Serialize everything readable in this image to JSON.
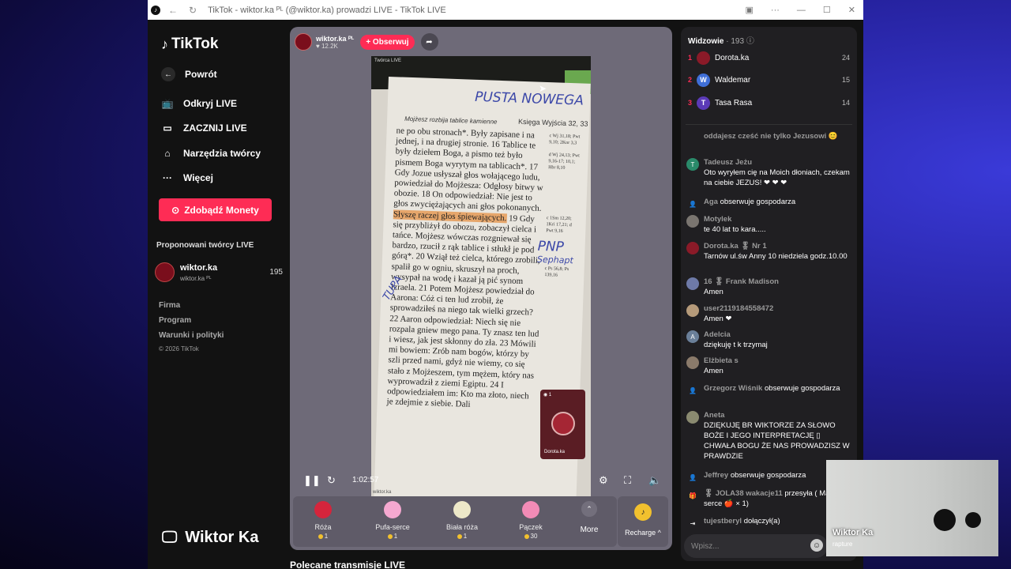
{
  "browser": {
    "title": "TikTok - wiktor.ka ᴾᴸ (@wiktor.ka) prowadzi LIVE - TikTok LIVE"
  },
  "sidebar": {
    "logo": "TikTok",
    "back": "Powrót",
    "items": [
      {
        "label": "Odkryj LIVE",
        "icon": "tv-icon"
      },
      {
        "label": "ZACZNIJ LIVE",
        "icon": "camera-icon"
      },
      {
        "label": "Narzędzia twórcy",
        "icon": "house-icon"
      },
      {
        "label": "Więcej",
        "icon": "dots-icon"
      }
    ],
    "coins_button": "Zdobądź Monety",
    "suggested_title": "Proponowani twórcy LIVE",
    "creator": {
      "name": "wiktor.ka",
      "handle": "wiktor.ka ᴾᴸ",
      "count": "195"
    },
    "footer": [
      "Firma",
      "Program",
      "Warunki i polityki"
    ],
    "copyright": "© 2026 TikTok",
    "bottom_name": "Wiktor Ka"
  },
  "stage": {
    "host": {
      "name": "wiktor.ka ᴾᴸ",
      "likes": "♥ 12.2K"
    },
    "follow": "+ Obserwuj",
    "video_label": "Twórca LIVE",
    "watermark": "wiktor.ka",
    "time": "1:02:57",
    "pip": {
      "name": "Dorota.ka",
      "count": "◉ 1"
    },
    "bible": {
      "header_left": "Mojżesz rozbija tablice kamienne",
      "header_right": "Księga Wyjścia 32, 33",
      "before": "ne po obu stronach*. Były zapisane i na jednej, i na drugiej stronie. 16 Tablice te były dziełem Boga, a pismo też było pismem Boga wyrytym na tablicach*. 17 Gdy Jozue usłyszał głos wołającego ludu, powiedział do Mojżesza: Odgłosy bitwy w obozie. 18 On odpowiedział: Nie jest to głos zwyciężających ani głos pokonanych.",
      "highlight": "Słyszę raczej głos śpiewających.",
      "after": "19 Gdy się przybliżył do obozu, zobaczył cielca i tańce. Mojżesz wówczas rozgniewał się bardzo, rzucił z rąk tablice i stłukł je pod górą*. 20 Wziął też cielca, którego zrobili, spalił go w ogniu, skruszył na proch, wysypał na wodę i kazał ją pić synom Izraela. 21 Potem Mojżesz powiedział do Aarona: Cóż ci ten lud zrobił, że sprowadziłeś na niego tak wielki grzech? 22 Aaron odpowiedział: Niech się nie rozpala gniew mego pana. Ty znasz ten lud i wiesz, jak jest skłonny do zła. 23 Mówili mi bowiem: Zrób nam bogów, którzy by szli przed nami, gdyż nie wiemy, co się stało z Mojżeszem, tym mężem, który nas wyprowadził z ziemi Egiptu. 24 I odpowiedziałem im: Kto ma złoto, niech je zdejmie z siebie. Dali",
      "margin_notes": [
        "c Wj 31,18; Pwt 9,10; 2Kor 3,3",
        "d Wj 24,13; Pwt 9,16-17; 10,1; Hbr 8,10",
        "c 1Sm 12,20; 1Kri 17,21; d Pwt 9,16",
        "c Ps 56,8; Ps 139,16"
      ],
      "handwriting": [
        "PUSTA NOWEGA",
        "PNP",
        "Sephapt",
        "TUPA"
      ]
    },
    "gifts": [
      {
        "name": "Róża",
        "price": "1",
        "color": "#d4253c"
      },
      {
        "name": "Pufa-serce",
        "price": "1",
        "color": "#f5a8d0"
      },
      {
        "name": "Biała róża",
        "price": "1",
        "color": "#ede8c8"
      },
      {
        "name": "Pączek",
        "price": "30",
        "color": "#f28bb6"
      }
    ],
    "more": "More",
    "recharge": "Recharge ^",
    "below": "Polecane transmisje LIVE"
  },
  "chat": {
    "viewers_title": "Widzowie",
    "viewers_count": "· 193",
    "top": [
      {
        "rank": "1",
        "name": "Dorota.ka",
        "score": "24",
        "color": "#8a1a28",
        "initial": ""
      },
      {
        "rank": "2",
        "name": "Waldemar",
        "score": "15",
        "color": "#3f6fd8",
        "initial": "W"
      },
      {
        "rank": "3",
        "name": "Tasa Rasa",
        "score": "14",
        "color": "#5b3ab7",
        "initial": "T"
      }
    ],
    "messages": [
      {
        "user": "",
        "text": "oddajesz cześć nie tylko Jezusowi 😊",
        "av": "",
        "avcolor": "transparent"
      },
      {
        "user": "Tadeusz Jeżu",
        "text": "Oto wyryłem cię na Moich dłoniach, czekam na ciebie JEZUS! ❤ ❤ ❤",
        "av": "T",
        "avcolor": "#2a8a6a"
      },
      {
        "user": "Aga",
        "text": "obserwuje gospodarza",
        "av": "👤",
        "avcolor": "transparent"
      },
      {
        "user": "Motylek",
        "text": "te 40 lat to kara.....",
        "av": "",
        "avcolor": "#7a7570"
      },
      {
        "user": "Dorota.ka 🎖 Nr 1",
        "text": "Tarnów ul.św Anny 10 niedziela godz.10.00",
        "av": "",
        "avcolor": "#8a1a28"
      },
      {
        "user": "16 🎖 Frank Madison",
        "text": "Amen",
        "av": "",
        "avcolor": "#6e7aa8"
      },
      {
        "user": "user2119184558472",
        "text": "Amen ❤",
        "av": "",
        "avcolor": "#b59a7a"
      },
      {
        "user": "Adelcia",
        "text": "dziękuję t k trzymaj",
        "av": "A",
        "avcolor": "#6a7f99"
      },
      {
        "user": "Elżbieta s",
        "text": "Amen",
        "av": "",
        "avcolor": "#8a7a6a"
      },
      {
        "user": "Grzegorz Wiśnik",
        "text": "obserwuje gospodarza",
        "av": "👤",
        "avcolor": "transparent"
      },
      {
        "user": "Aneta",
        "text": "DZIĘKUJĘ BR WIKTORZE ZA SŁOWO BOŻE I JEGO INTERPRETACJĘ ▯ CHWAŁA BOGU ŻE NAS PROWADZISZ W PRAWDZIE",
        "av": "",
        "avcolor": "#8a8a70"
      },
      {
        "user": "Jeffrey",
        "text": "obserwuje gospodarza",
        "av": "👤",
        "avcolor": "transparent"
      },
      {
        "user": "🎖 JOLA38 wakacje11",
        "text": "przesyła ( Masz serce 🍎 × 1)",
        "av": "🎁",
        "avcolor": "transparent"
      },
      {
        "user": "tujestberyl",
        "text": "dołączył(a)",
        "av": "⇥",
        "avcolor": "transparent"
      }
    ],
    "input_placeholder": "Wpisz..."
  },
  "cam": {
    "name": "Wiktor Ka",
    "sub": "rapture"
  }
}
